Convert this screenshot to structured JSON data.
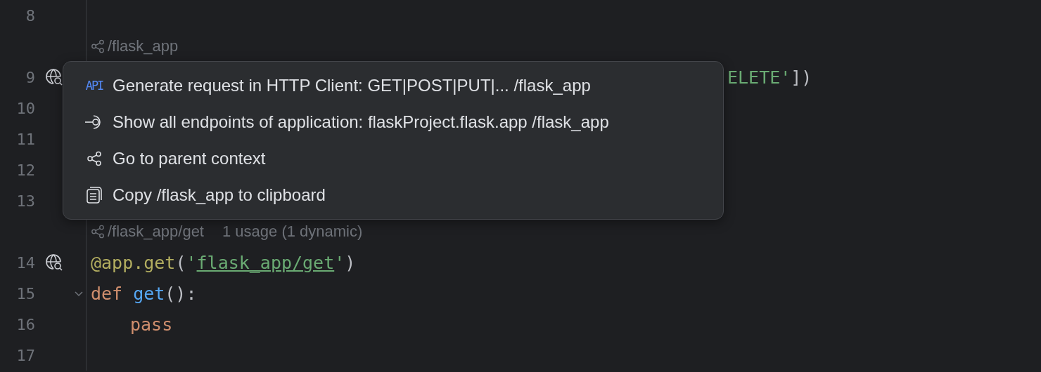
{
  "editor": {
    "rows": [
      {
        "kind": "line",
        "number": "8",
        "tokens": []
      },
      {
        "kind": "inlay",
        "path": "/flask_app"
      },
      {
        "kind": "line",
        "number": "9",
        "gutter": {
          "kind": "endpoint"
        },
        "covered": true,
        "tokens": [
          {
            "text": "ELETE'",
            "kind": "string"
          },
          {
            "text": "])",
            "kind": "plain"
          }
        ]
      },
      {
        "kind": "line",
        "number": "10",
        "tokens": []
      },
      {
        "kind": "line",
        "number": "11",
        "tokens": []
      },
      {
        "kind": "line",
        "number": "12",
        "tokens": []
      },
      {
        "kind": "line",
        "number": "13",
        "tokens": []
      },
      {
        "kind": "inlay",
        "path": "/flask_app/get",
        "usage": "1 usage (1 dynamic)"
      },
      {
        "kind": "line",
        "number": "14",
        "gutter": {
          "kind": "endpoint"
        },
        "tokens": [
          {
            "text": "@app.get",
            "kind": "decorator"
          },
          {
            "text": "(",
            "kind": "plain"
          },
          {
            "text": "'",
            "kind": "string"
          },
          {
            "text": "flask_app/get",
            "kind": "link"
          },
          {
            "text": "'",
            "kind": "string"
          },
          {
            "text": ")",
            "kind": "plain"
          }
        ]
      },
      {
        "kind": "line",
        "number": "15",
        "gutter": {
          "kind": "fold"
        },
        "tokens": [
          {
            "text": "def",
            "kind": "keyword"
          },
          {
            "text": "get",
            "kind": "function"
          },
          {
            "text": "():",
            "kind": "plain"
          }
        ]
      },
      {
        "kind": "line",
        "number": "16",
        "indented": true,
        "tokens": [
          {
            "text": "pass",
            "kind": "keyword"
          }
        ]
      },
      {
        "kind": "line",
        "number": "17",
        "tokens": []
      }
    ]
  },
  "popup": {
    "items": [
      {
        "kind": "api",
        "badge": "API",
        "label": "Generate request in HTTP Client: GET|POST|PUT|... /flask_app"
      },
      {
        "kind": "endpoints",
        "label": "Show all endpoints of application: flaskProject.flask.app /flask_app"
      },
      {
        "kind": "share",
        "label": "Go to parent context"
      },
      {
        "kind": "copy",
        "label": "Copy /flask_app to clipboard"
      }
    ]
  }
}
